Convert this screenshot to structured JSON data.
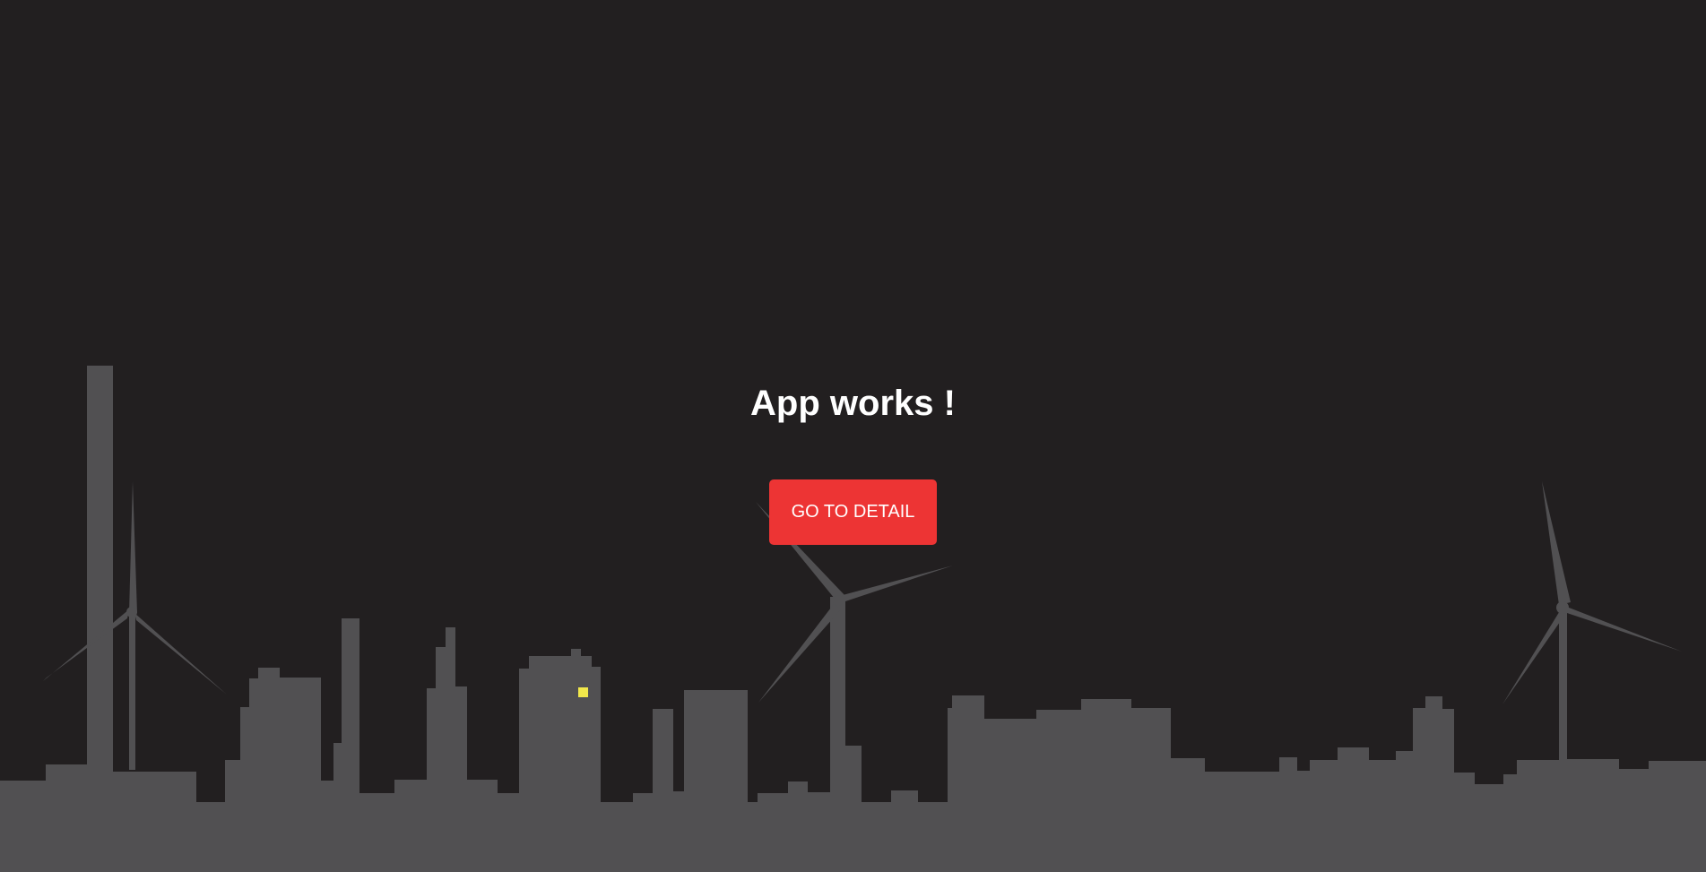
{
  "main": {
    "title": "App works !",
    "cta_label": "GO TO DETAIL"
  },
  "colors": {
    "background": "#221f20",
    "skyline": "#515052",
    "button": "#ed3434",
    "lit_window": "#f2e84b"
  },
  "scene": {
    "icons": [
      "factory-skyline",
      "wind-turbine",
      "lit-window"
    ]
  }
}
